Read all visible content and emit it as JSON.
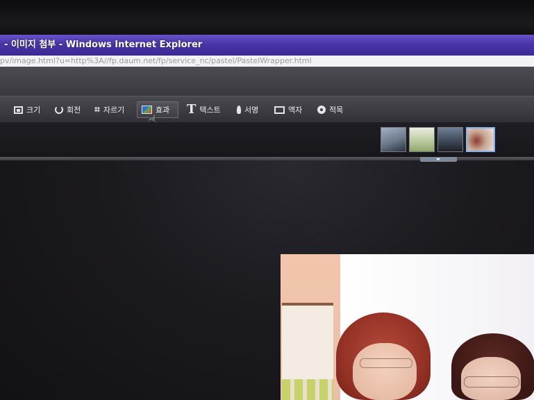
{
  "window": {
    "title": "- 이미지 첨부 - Windows Internet Explorer",
    "address": "pv/image.html?u=http%3A//fp.daum.net/fp/service_nc/pastel/PastelWrapper.html"
  },
  "toolbar": {
    "items": [
      {
        "label": "크기",
        "icon": "resize-icon"
      },
      {
        "label": "회전",
        "icon": "rotate-icon"
      },
      {
        "label": "자르기",
        "icon": "crop-icon"
      },
      {
        "label": "효과",
        "icon": "effect-icon",
        "active": true
      },
      {
        "label": "텍스트",
        "icon": "text-icon"
      },
      {
        "label": "서명",
        "icon": "signature-icon"
      },
      {
        "label": "액자",
        "icon": "frame-icon"
      },
      {
        "label": "적목",
        "icon": "red-eye-icon"
      }
    ]
  },
  "thumbnails": {
    "count": 4,
    "selected_index": 3,
    "colors": {
      "thumb1": "#6c7a8c",
      "thumb2": "#b7c79a",
      "thumb3": "#3b4552",
      "thumb4": "#c9a896"
    }
  },
  "colors": {
    "title_bar": "#4a33a8",
    "toolbar_bg": "#3a393f",
    "selected_thumb_border": "#7fb2ef"
  }
}
